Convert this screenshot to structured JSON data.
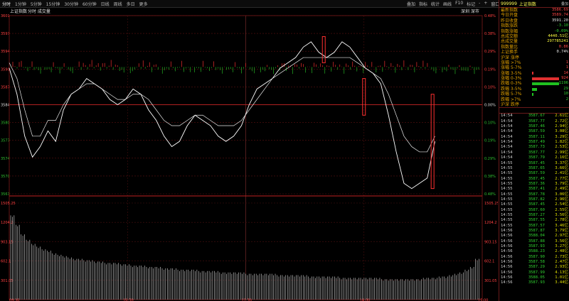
{
  "toolbar": {
    "periods": [
      "分时",
      "1分钟",
      "5分钟",
      "15分钟",
      "30分钟",
      "60分钟",
      "日线",
      "周线",
      "多日",
      "更多"
    ],
    "active_period": 0,
    "tools": [
      "叠加",
      "指标",
      "统计",
      "画线",
      "F10",
      "标记",
      "-",
      "+",
      "窗口",
      "▾"
    ]
  },
  "chart_header": {
    "index_name": "上证指数",
    "overlay": "分时 成交量",
    "right_note": "深圳 深市"
  },
  "price_axis": [
    "3601",
    "3597",
    "3594",
    "3590",
    "3587",
    "3584",
    "3580",
    "3577",
    "3574",
    "3570",
    "3567"
  ],
  "pct_axis": [
    "0.48%",
    "0.38%",
    "0.29%",
    "0.19%",
    "0.10%",
    "0.00%",
    "0.10%",
    "0.19%",
    "0.29%",
    "0.38%",
    "0.48%"
  ],
  "volume_axis": [
    "1505.25",
    "1204.2",
    "903.15",
    "602.1",
    "301.05"
  ],
  "time_axis": [
    "09:30",
    "10:30",
    "11:30",
    "14:00",
    "15:00"
  ],
  "chart_data": {
    "type": "line",
    "x_range": [
      0,
      100
    ],
    "ylim": [
      3567,
      3601
    ],
    "series": [
      {
        "color": "#ffffff",
        "values": [
          3591,
          3586,
          3578,
          3574,
          3576,
          3579,
          3577,
          3583,
          3586,
          3587,
          3589,
          3588,
          3587,
          3585,
          3584,
          3585,
          3587,
          3586,
          3583,
          3581,
          3578,
          3576,
          3577,
          3580,
          3582,
          3581,
          3580,
          3578,
          3577,
          3578,
          3580,
          3584,
          3587,
          3588,
          3589,
          3591,
          3592,
          3593,
          3595,
          3596,
          3594,
          3593,
          3594,
          3596,
          3595,
          3593,
          3591,
          3590,
          3588,
          3582,
          3575,
          3569,
          3568,
          3569,
          3570,
          3577
        ]
      },
      {
        "color": "#e8e8e8",
        "values": [
          3592,
          3589,
          3583,
          3578,
          3578,
          3581,
          3581,
          3584,
          3586,
          3587,
          3588,
          3588,
          3587,
          3586,
          3585,
          3585,
          3586,
          3586,
          3585,
          3583,
          3581,
          3580,
          3580,
          3581,
          3582,
          3582,
          3581,
          3580,
          3580,
          3580,
          3581,
          3583,
          3585,
          3587,
          3589,
          3590,
          3591,
          3592,
          3593,
          3593,
          3593,
          3593,
          3593,
          3593,
          3593,
          3592,
          3591,
          3590,
          3589,
          3586,
          3582,
          3578,
          3576,
          3575,
          3575,
          3578
        ]
      }
    ],
    "volume": [
      62,
      55,
      48,
      44,
      41,
      39,
      37,
      36,
      34,
      33,
      32,
      31,
      30,
      30,
      29,
      29,
      28,
      28,
      27,
      27,
      27,
      26,
      26,
      25,
      25,
      25,
      24,
      24,
      24,
      23,
      23,
      23,
      22,
      22,
      22,
      22,
      21,
      21,
      21,
      21,
      20,
      20,
      20,
      20,
      20,
      19,
      19,
      19,
      19,
      19,
      19,
      18,
      18,
      18,
      18,
      18,
      18,
      17,
      17,
      17,
      17,
      17,
      17,
      16,
      16,
      16,
      16,
      16,
      16,
      16,
      16,
      15,
      15,
      15,
      15,
      15,
      15,
      15,
      15,
      16,
      16,
      16,
      17,
      17,
      18,
      19,
      20,
      22,
      24,
      30
    ],
    "highlights": [
      [
        66.5,
        3592,
        3597
      ],
      [
        75.0,
        3582,
        3589
      ],
      [
        89.5,
        3568,
        3586
      ]
    ]
  },
  "quote": {
    "code": "999999",
    "name": "上证指数",
    "ext": "叠加",
    "stats": [
      {
        "label": "最新指数",
        "value": "3586.69",
        "cls": "red"
      },
      {
        "label": "今日开盘",
        "value": "3589.74",
        "cls": "red"
      },
      {
        "label": "昨日收盘",
        "value": "3591.20",
        "cls": "white"
      },
      {
        "label": "指数涨跌",
        "value": "-3.10",
        "cls": "green"
      },
      {
        "label": "指数涨幅",
        "value": "-0.09%",
        "cls": "green"
      },
      {
        "label": "总成交额",
        "value": "4440.51亿",
        "cls": "yellow"
      },
      {
        "label": "总成交量",
        "value": "297785241",
        "cls": "yellow"
      },
      {
        "label": "指数量比",
        "value": "0.86",
        "cls": "red"
      },
      {
        "label": "上证换手",
        "value": "0.74%",
        "cls": "white"
      }
    ],
    "dist_header": "沪深 涨停",
    "dist": [
      {
        "label": "涨幅 >7%",
        "value": "1",
        "bar": 0,
        "cls": "red"
      },
      {
        "label": "涨幅 5-7%",
        "value": "1",
        "bar": 0,
        "cls": "red"
      },
      {
        "label": "涨幅 3-5%",
        "value": "14",
        "bar": 2,
        "cls": "red"
      },
      {
        "label": "涨幅 0-3%",
        "value": "924",
        "bar": 38,
        "cls": "red"
      },
      {
        "label": "跌幅 0-3%",
        "value": "1196",
        "bar": 48,
        "cls": "green"
      },
      {
        "label": "跌幅 3-5%",
        "value": "29",
        "bar": 7,
        "cls": "green"
      },
      {
        "label": "跌幅 5-7%",
        "value": "10",
        "bar": 2,
        "cls": "green"
      },
      {
        "label": "跌幅 >7%",
        "value": "2",
        "bar": 0,
        "cls": "green"
      },
      {
        "label": "沪深 跌停",
        "value": "",
        "bar": 0,
        "cls": "green"
      }
    ],
    "ticks": [
      [
        "14:54",
        "3587.67",
        "2.61亿"
      ],
      [
        "14:54",
        "3587.77",
        "2.72亿"
      ],
      [
        "14:54",
        "3587.46",
        "2.94亿"
      ],
      [
        "14:54",
        "3587.59",
        "3.08亿"
      ],
      [
        "14:54",
        "3587.11",
        "3.29亿"
      ],
      [
        "14:54",
        "3587.49",
        "1.82亿"
      ],
      [
        "14:54",
        "3587.73",
        "2.53亿"
      ],
      [
        "14:54",
        "3587.77",
        "2.99亿"
      ],
      [
        "14:54",
        "3587.79",
        "2.16亿"
      ],
      [
        "14:55",
        "3587.45",
        "3.37亿"
      ],
      [
        "14:55",
        "3587.65",
        "3.66亿"
      ],
      [
        "14:55",
        "3587.59",
        "2.41亿"
      ],
      [
        "14:55",
        "3587.45",
        "2.77亿"
      ],
      [
        "14:55",
        "3587.36",
        "3.79亿"
      ],
      [
        "14:55",
        "3587.41",
        "2.49亿"
      ],
      [
        "14:55",
        "3587.78",
        "3.06亿"
      ],
      [
        "14:55",
        "3587.82",
        "2.96亿"
      ],
      [
        "14:55",
        "3587.45",
        "2.54亿"
      ],
      [
        "14:55",
        "3587.60",
        "2.55亿"
      ],
      [
        "14:55",
        "3587.27",
        "3.56亿"
      ],
      [
        "14:55",
        "3587.55",
        "2.78亿"
      ],
      [
        "14:55",
        "3587.57",
        "3.46亿"
      ],
      [
        "14:56",
        "3587.87",
        "3.79亿"
      ],
      [
        "14:56",
        "3588.04",
        "2.97亿"
      ],
      [
        "14:56",
        "3587.88",
        "3.56亿"
      ],
      [
        "14:56",
        "3587.93",
        "3.27亿"
      ],
      [
        "14:56",
        "3588.23",
        "2.48亿"
      ],
      [
        "14:56",
        "3587.90",
        "2.73亿"
      ],
      [
        "14:56",
        "3587.58",
        "2.47亿"
      ],
      [
        "14:56",
        "3587.29",
        "2.93亿"
      ],
      [
        "14:56",
        "3587.99",
        "4.13亿"
      ],
      [
        "14:56",
        "3588.05",
        "1.01亿"
      ],
      [
        "14:56",
        "3587.93",
        "3.44亿"
      ]
    ]
  }
}
